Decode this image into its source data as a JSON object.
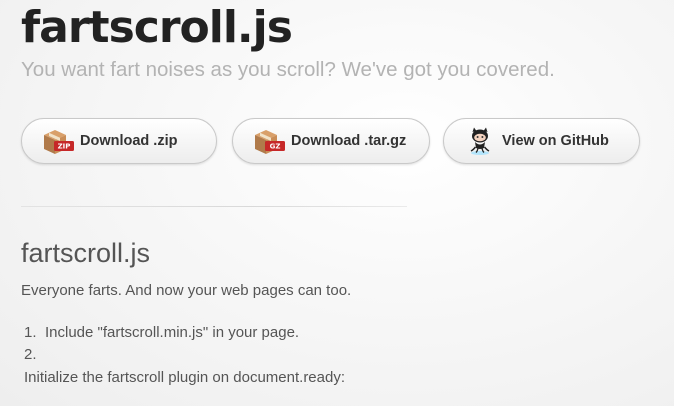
{
  "header": {
    "title": "fartscroll.js",
    "tagline": "You want fart noises as you scroll? We've got you covered."
  },
  "downloads": {
    "zip": {
      "label": "Download .zip",
      "badge": "ZIP",
      "icon": "zip-archive-icon"
    },
    "tar": {
      "label": "Download .tar.gz",
      "badge": "GZ",
      "icon": "tar-archive-icon"
    },
    "github": {
      "label": "View on GitHub",
      "icon": "octocat-icon"
    }
  },
  "content": {
    "title": "fartscroll.js",
    "intro": "Everyone farts. And now your web pages can too.",
    "steps": [
      {
        "number": "1.",
        "text": "Include \"fartscroll.min.js\" in your page."
      },
      {
        "number": "2.",
        "text": ""
      }
    ],
    "step2_text": "Initialize the fartscroll plugin on document.ready:"
  },
  "colors": {
    "title": "#222222",
    "tagline": "#b3b3b3",
    "body_text": "#555555",
    "box_brown": "#b07a4a",
    "badge_red": "#c62828"
  }
}
